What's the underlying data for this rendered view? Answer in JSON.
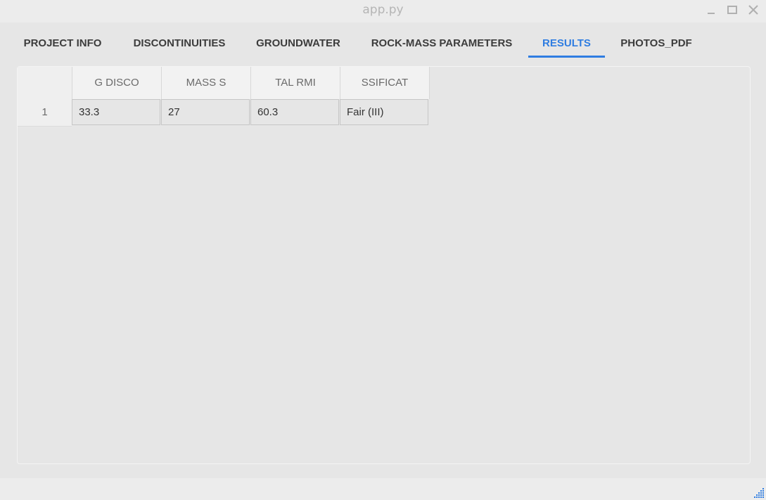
{
  "window": {
    "title": "app.py",
    "accent_color": "#2f7de1"
  },
  "tabs": [
    {
      "label": "PROJECT INFO",
      "active": false
    },
    {
      "label": "DISCONTINUITIES",
      "active": false
    },
    {
      "label": "GROUNDWATER",
      "active": false
    },
    {
      "label": "ROCK-MASS PARAMETERS",
      "active": false
    },
    {
      "label": "RESULTS",
      "active": true
    },
    {
      "label": "PHOTOS_PDF",
      "active": false
    }
  ],
  "table": {
    "columns": [
      "G DISCO",
      "MASS S",
      "TAL RMI",
      "SSIFICAT"
    ],
    "rows": [
      {
        "index": "1",
        "cells": [
          "33.3",
          "27",
          "60.3",
          "Fair (III)"
        ]
      }
    ]
  },
  "icons": {
    "minimize": "minimize-icon",
    "maximize": "maximize-icon",
    "close": "close-icon",
    "resize": "resize-grip-icon"
  }
}
